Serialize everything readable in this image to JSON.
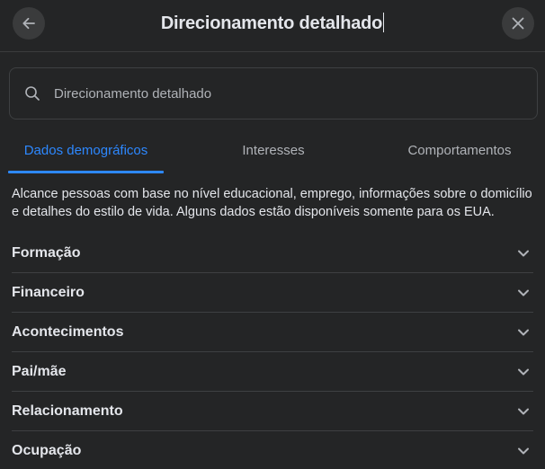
{
  "header": {
    "title": "Direcionamento detalhado",
    "back_icon": "arrow-left-icon",
    "close_icon": "close-icon"
  },
  "search": {
    "placeholder": "Direcionamento detalhado",
    "value": "",
    "icon": "search-icon"
  },
  "tabs": [
    {
      "label": "Dados demográficos",
      "active": true
    },
    {
      "label": "Interesses",
      "active": false
    },
    {
      "label": "Comportamentos",
      "active": false
    }
  ],
  "description": "Alcance pessoas com base no nível educacional, emprego, informações sobre o domicílio e detalhes do estilo de vida. Alguns dados estão disponíveis somente para os EUA.",
  "categories": [
    {
      "label": "Formação",
      "icon": "chevron-down-icon"
    },
    {
      "label": "Financeiro",
      "icon": "chevron-down-icon"
    },
    {
      "label": "Acontecimentos",
      "icon": "chevron-down-icon"
    },
    {
      "label": "Pai/mãe",
      "icon": "chevron-down-icon"
    },
    {
      "label": "Relacionamento",
      "icon": "chevron-down-icon"
    },
    {
      "label": "Ocupação",
      "icon": "chevron-down-icon"
    }
  ],
  "colors": {
    "background": "#242526",
    "accent": "#2d88ff",
    "text_primary": "#e4e6eb",
    "text_secondary": "#b0b3b8",
    "button_bg": "#3a3b3c"
  }
}
